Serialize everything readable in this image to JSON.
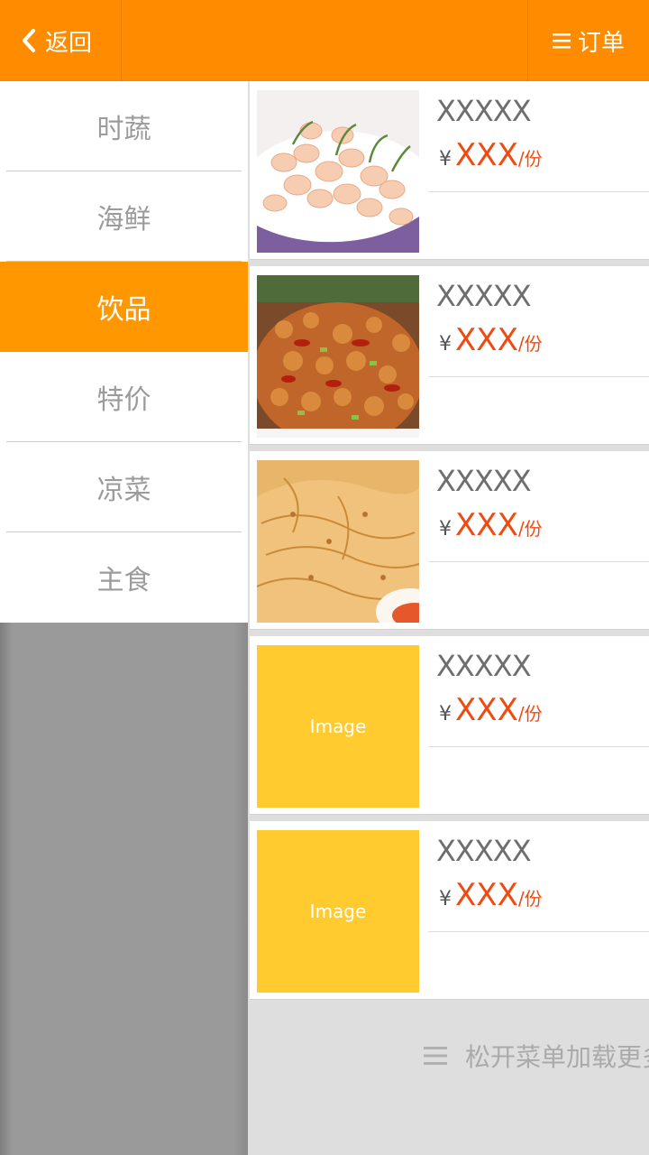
{
  "header": {
    "back_label": "返回",
    "order_label": "订单"
  },
  "sidebar": {
    "categories": [
      {
        "label": "时蔬",
        "active": false
      },
      {
        "label": "海鲜",
        "active": false
      },
      {
        "label": "饮品",
        "active": true
      },
      {
        "label": "特价",
        "active": false
      },
      {
        "label": "凉菜",
        "active": false
      },
      {
        "label": "主食",
        "active": false
      }
    ]
  },
  "products": [
    {
      "name": "XXXXX",
      "currency": "¥",
      "price": "XXX",
      "unit": "/份",
      "image": "shrimp-dish-photo"
    },
    {
      "name": "XXXXX",
      "currency": "¥",
      "price": "XXX",
      "unit": "/份",
      "image": "kungpao-chicken-photo"
    },
    {
      "name": "XXXXX",
      "currency": "¥",
      "price": "XXX",
      "unit": "/份",
      "image": "flatbread-photo"
    },
    {
      "name": "XXXXX",
      "currency": "¥",
      "price": "XXX",
      "unit": "/份",
      "image_label": "Image"
    },
    {
      "name": "XXXXX",
      "currency": "¥",
      "price": "XXX",
      "unit": "/份",
      "image_label": "Image"
    }
  ],
  "load_more": "松开菜单加载更多",
  "colors": {
    "brand": "#ff8c00",
    "active_category": "#ff9800",
    "price": "#ef4a10",
    "placeholder": "#ffcb2e"
  }
}
